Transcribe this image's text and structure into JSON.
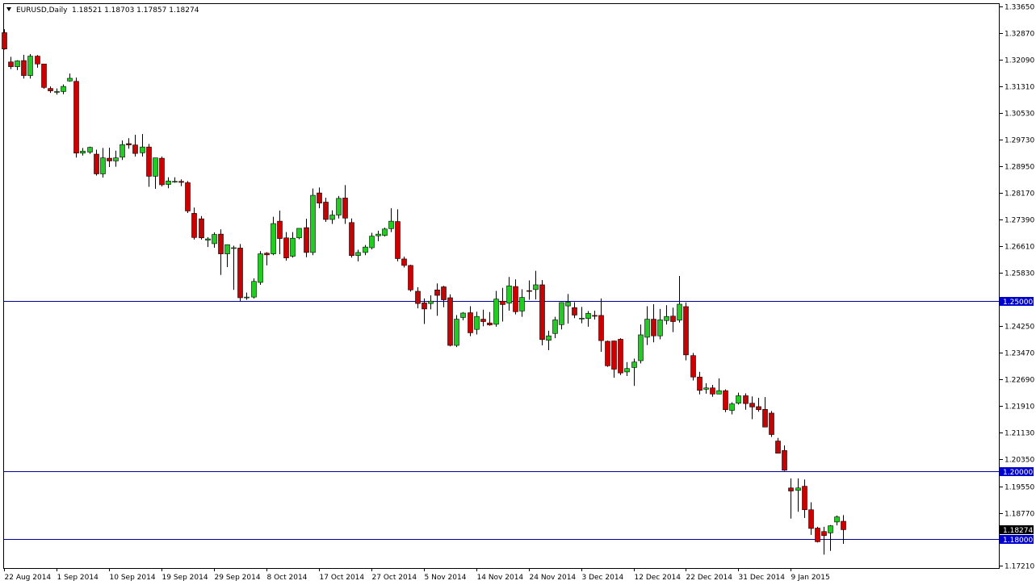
{
  "header": {
    "symbol_label": "EURUSD,Daily",
    "ohlc": "1.18521 1.18703 1.17857 1.18274",
    "menu_arrow_icon": "triangle-down-icon"
  },
  "colors": {
    "bull": "#22cc22",
    "bear": "#cc0000",
    "outline": "#000000",
    "level_line": "#000099",
    "level_tag": "#0000cc",
    "price_tag": "#000000"
  },
  "chart_data": {
    "type": "candlestick",
    "title": "EURUSD,Daily",
    "ylim": [
      1.1717,
      1.3365
    ],
    "y_ticks": [
      "1.33650",
      "1.32870",
      "1.32090",
      "1.31310",
      "1.30530",
      "1.29730",
      "1.28950",
      "1.28170",
      "1.27390",
      "1.26610",
      "1.25830",
      "1.24250",
      "1.23470",
      "1.22690",
      "1.21910",
      "1.21130",
      "1.20350",
      "1.19550",
      "1.18770",
      "1.17210"
    ],
    "x_tick_labels": [
      "22 Aug 2014",
      "1 Sep 2014",
      "10 Sep 2014",
      "19 Sep 2014",
      "29 Sep 2014",
      "8 Oct 2014",
      "17 Oct 2014",
      "27 Oct 2014",
      "5 Nov 2014",
      "14 Nov 2014",
      "24 Nov 2014",
      "3 Dec 2014",
      "12 Dec 2014",
      "22 Dec 2014",
      "31 Dec 2014",
      "9 Jan 2015"
    ],
    "x_tick_index": [
      0,
      8,
      16,
      24,
      32,
      40,
      48,
      56,
      64,
      72,
      80,
      88,
      96,
      104,
      112,
      120
    ],
    "horizontal_levels": [
      {
        "value": 1.25,
        "label": "1.25000"
      },
      {
        "value": 1.2,
        "label": "1.20000"
      },
      {
        "value": 1.18,
        "label": "1.18000"
      }
    ],
    "current_price": {
      "value": 1.18274,
      "label": "1.18274"
    },
    "candles": [
      [
        1.3288,
        1.3298,
        1.3238,
        1.324
      ],
      [
        1.3202,
        1.3217,
        1.3181,
        1.3188
      ],
      [
        1.3188,
        1.3207,
        1.3178,
        1.3205
      ],
      [
        1.3206,
        1.3223,
        1.3153,
        1.3162
      ],
      [
        1.3162,
        1.3225,
        1.3153,
        1.3219
      ],
      [
        1.3219,
        1.3222,
        1.3185,
        1.3196
      ],
      [
        1.3196,
        1.3196,
        1.3123,
        1.3127
      ],
      [
        1.3124,
        1.313,
        1.3111,
        1.3117
      ],
      [
        1.3115,
        1.3124,
        1.3106,
        1.3115
      ],
      [
        1.3115,
        1.3136,
        1.3107,
        1.313
      ],
      [
        1.3146,
        1.3168,
        1.3144,
        1.3154
      ],
      [
        1.3145,
        1.3156,
        1.2921,
        1.2934
      ],
      [
        1.2934,
        1.2949,
        1.2927,
        1.294
      ],
      [
        1.2937,
        1.2953,
        1.2932,
        1.2951
      ],
      [
        1.2931,
        1.2944,
        1.2868,
        1.2873
      ],
      [
        1.2873,
        1.2949,
        1.2862,
        1.292
      ],
      [
        1.2919,
        1.295,
        1.2893,
        1.2911
      ],
      [
        1.2911,
        1.2941,
        1.2894,
        1.292
      ],
      [
        1.2922,
        1.2971,
        1.2914,
        1.2959
      ],
      [
        1.2962,
        1.2978,
        1.2947,
        1.2958
      ],
      [
        1.2958,
        1.2988,
        1.2924,
        1.2933
      ],
      [
        1.2935,
        1.299,
        1.2924,
        1.2952
      ],
      [
        1.2952,
        1.2961,
        1.2835,
        1.2866
      ],
      [
        1.2866,
        1.2918,
        1.2829,
        1.292
      ],
      [
        1.2919,
        1.2924,
        1.2836,
        1.2841
      ],
      [
        1.2842,
        1.2863,
        1.2831,
        1.2852
      ],
      [
        1.285,
        1.2863,
        1.2847,
        1.2851
      ],
      [
        1.2851,
        1.2857,
        1.2837,
        1.2848
      ],
      [
        1.2847,
        1.2852,
        1.2758,
        1.2764
      ],
      [
        1.2757,
        1.2774,
        1.268,
        1.2686
      ],
      [
        1.2741,
        1.2749,
        1.268,
        1.2685
      ],
      [
        1.2678,
        1.2687,
        1.2658,
        1.2682
      ],
      [
        1.2668,
        1.2701,
        1.2656,
        1.2695
      ],
      [
        1.2696,
        1.271,
        1.2576,
        1.2638
      ],
      [
        1.2638,
        1.266,
        1.2599,
        1.2665
      ],
      [
        1.2654,
        1.2662,
        1.2532,
        1.2656
      ],
      [
        1.2655,
        1.2667,
        1.2498,
        1.2509
      ],
      [
        1.2511,
        1.2524,
        1.2503,
        1.2511
      ],
      [
        1.2511,
        1.2566,
        1.2507,
        1.2557
      ],
      [
        1.2554,
        1.2646,
        1.2547,
        1.2638
      ],
      [
        1.264,
        1.2643,
        1.2604,
        1.2635
      ],
      [
        1.2638,
        1.2747,
        1.2634,
        1.2727
      ],
      [
        1.2734,
        1.2765,
        1.2637,
        1.2683
      ],
      [
        1.2685,
        1.2702,
        1.2618,
        1.2626
      ],
      [
        1.2631,
        1.2702,
        1.2627,
        1.2684
      ],
      [
        1.2685,
        1.2708,
        1.2681,
        1.2713
      ],
      [
        1.2715,
        1.2741,
        1.2628,
        1.2642
      ],
      [
        1.2642,
        1.283,
        1.2634,
        1.281
      ],
      [
        1.2817,
        1.2833,
        1.2772,
        1.2787
      ],
      [
        1.279,
        1.2803,
        1.2732,
        1.2739
      ],
      [
        1.2739,
        1.2766,
        1.2726,
        1.2752
      ],
      [
        1.2752,
        1.2808,
        1.2742,
        1.2801
      ],
      [
        1.2802,
        1.284,
        1.2726,
        1.2743
      ],
      [
        1.273,
        1.2742,
        1.2627,
        1.2633
      ],
      [
        1.2633,
        1.265,
        1.2616,
        1.2642
      ],
      [
        1.2642,
        1.2664,
        1.2634,
        1.2658
      ],
      [
        1.2656,
        1.27,
        1.2651,
        1.269
      ],
      [
        1.2691,
        1.2706,
        1.2675,
        1.2696
      ],
      [
        1.2692,
        1.2715,
        1.2689,
        1.2711
      ],
      [
        1.2712,
        1.2772,
        1.2702,
        1.2734
      ],
      [
        1.2733,
        1.2769,
        1.2616,
        1.2624
      ],
      [
        1.2623,
        1.263,
        1.2598,
        1.2604
      ],
      [
        1.2604,
        1.2606,
        1.2527,
        1.2532
      ],
      [
        1.2528,
        1.254,
        1.2478,
        1.2492
      ],
      [
        1.2494,
        1.2507,
        1.2432,
        1.2476
      ],
      [
        1.2492,
        1.2516,
        1.2475,
        1.2499
      ],
      [
        1.2532,
        1.2551,
        1.2456,
        1.2516
      ],
      [
        1.2541,
        1.2544,
        1.2481,
        1.2503
      ],
      [
        1.2509,
        1.2519,
        1.2366,
        1.2369
      ],
      [
        1.2369,
        1.2458,
        1.2364,
        1.2446
      ],
      [
        1.2451,
        1.2467,
        1.2443,
        1.2464
      ],
      [
        1.2465,
        1.2484,
        1.2396,
        1.2406
      ],
      [
        1.2416,
        1.2468,
        1.2401,
        1.2454
      ],
      [
        1.2446,
        1.2474,
        1.2425,
        1.2439
      ],
      [
        1.2435,
        1.2467,
        1.2427,
        1.2429
      ],
      [
        1.2431,
        1.2529,
        1.2424,
        1.2505
      ],
      [
        1.2499,
        1.2538,
        1.2439,
        1.2489
      ],
      [
        1.2493,
        1.257,
        1.2471,
        1.2544
      ],
      [
        1.2542,
        1.2563,
        1.246,
        1.2468
      ],
      [
        1.247,
        1.2534,
        1.2453,
        1.251
      ],
      [
        1.253,
        1.256,
        1.2503,
        1.2529
      ],
      [
        1.2533,
        1.2588,
        1.2504,
        1.2547
      ],
      [
        1.2547,
        1.2561,
        1.2369,
        1.2386
      ],
      [
        1.2384,
        1.2412,
        1.2355,
        1.2397
      ],
      [
        1.2404,
        1.2453,
        1.239,
        1.2444
      ],
      [
        1.243,
        1.2496,
        1.2416,
        1.2495
      ],
      [
        1.2485,
        1.252,
        1.2433,
        1.2496
      ],
      [
        1.248,
        1.2496,
        1.2449,
        1.2458
      ],
      [
        1.2449,
        1.2482,
        1.2434,
        1.2449
      ],
      [
        1.2448,
        1.247,
        1.2424,
        1.2463
      ],
      [
        1.2457,
        1.2471,
        1.2445,
        1.2455
      ],
      [
        1.2457,
        1.2507,
        1.235,
        1.2383
      ],
      [
        1.2381,
        1.2383,
        1.2306,
        1.2309
      ],
      [
        1.2382,
        1.2383,
        1.2274,
        1.2299
      ],
      [
        1.2387,
        1.239,
        1.2282,
        1.2288
      ],
      [
        1.2291,
        1.232,
        1.2279,
        1.2301
      ],
      [
        1.2304,
        1.233,
        1.225,
        1.232
      ],
      [
        1.2324,
        1.243,
        1.2316,
        1.24
      ],
      [
        1.2393,
        1.2484,
        1.237,
        1.2446
      ],
      [
        1.2446,
        1.249,
        1.2378,
        1.2397
      ],
      [
        1.2397,
        1.2476,
        1.2387,
        1.2444
      ],
      [
        1.2442,
        1.2487,
        1.243,
        1.2454
      ],
      [
        1.2455,
        1.248,
        1.2408,
        1.2439
      ],
      [
        1.2443,
        1.2573,
        1.2436,
        1.249
      ],
      [
        1.2483,
        1.2495,
        1.2325,
        1.2341
      ],
      [
        1.2339,
        1.2347,
        1.2266,
        1.2276
      ],
      [
        1.2276,
        1.2291,
        1.2225,
        1.2237
      ],
      [
        1.224,
        1.2258,
        1.2227,
        1.2244
      ],
      [
        1.2244,
        1.2253,
        1.2218,
        1.2226
      ],
      [
        1.2226,
        1.2272,
        1.2226,
        1.2236
      ],
      [
        1.2236,
        1.224,
        1.2173,
        1.218
      ],
      [
        1.2178,
        1.2202,
        1.2166,
        1.2197
      ],
      [
        1.2199,
        1.223,
        1.2195,
        1.2221
      ],
      [
        1.2221,
        1.2228,
        1.218,
        1.2198
      ],
      [
        1.2199,
        1.2219,
        1.2152,
        1.2188
      ],
      [
        1.2189,
        1.2215,
        1.2174,
        1.218
      ],
      [
        1.2181,
        1.2217,
        1.2147,
        1.2129
      ],
      [
        1.217,
        1.2176,
        1.21,
        1.2107
      ],
      [
        1.2088,
        1.2097,
        1.2052,
        1.2052
      ],
      [
        1.206,
        1.2075,
        1.2,
        1.2002
      ],
      [
        1.195,
        1.1978,
        1.186,
        1.1941
      ],
      [
        1.1943,
        1.1978,
        1.188,
        1.195
      ],
      [
        1.1955,
        1.1975,
        1.1862,
        1.1886
      ],
      [
        1.1886,
        1.1908,
        1.1812,
        1.1831
      ],
      [
        1.1832,
        1.1836,
        1.179,
        1.1792
      ],
      [
        1.1822,
        1.1836,
        1.1754,
        1.181
      ],
      [
        1.1818,
        1.1841,
        1.1765,
        1.1839
      ],
      [
        1.185,
        1.1869,
        1.184,
        1.1865
      ],
      [
        1.18521,
        1.18703,
        1.17857,
        1.18274
      ]
    ]
  }
}
